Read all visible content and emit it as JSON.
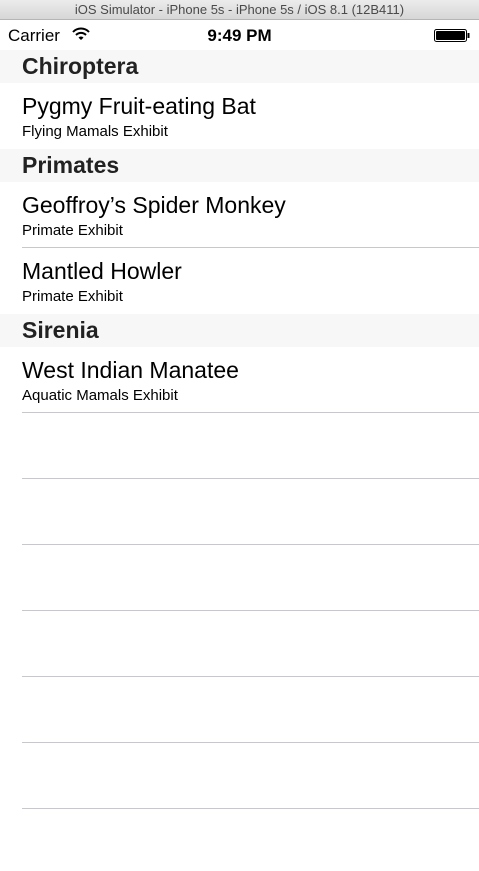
{
  "window": {
    "title": "iOS Simulator - iPhone 5s - iPhone 5s / iOS 8.1 (12B411)"
  },
  "status_bar": {
    "carrier": "Carrier",
    "time": "9:49 PM",
    "wifi_icon": "wifi-icon",
    "battery_icon": "battery-icon"
  },
  "sections": [
    {
      "title": "Chiroptera",
      "rows": [
        {
          "title": "Pygmy Fruit-eating Bat",
          "subtitle": "Flying Mamals Exhibit"
        }
      ]
    },
    {
      "title": "Primates",
      "rows": [
        {
          "title": "Geoffroy’s Spider Monkey",
          "subtitle": "Primate Exhibit"
        },
        {
          "title": "Mantled Howler",
          "subtitle": "Primate Exhibit"
        }
      ]
    },
    {
      "title": "Sirenia",
      "rows": [
        {
          "title": "West Indian Manatee",
          "subtitle": "Aquatic Mamals Exhibit"
        }
      ]
    }
  ],
  "colors": {
    "section_background": "#f7f7f7",
    "separator": "#c8c7cc"
  }
}
